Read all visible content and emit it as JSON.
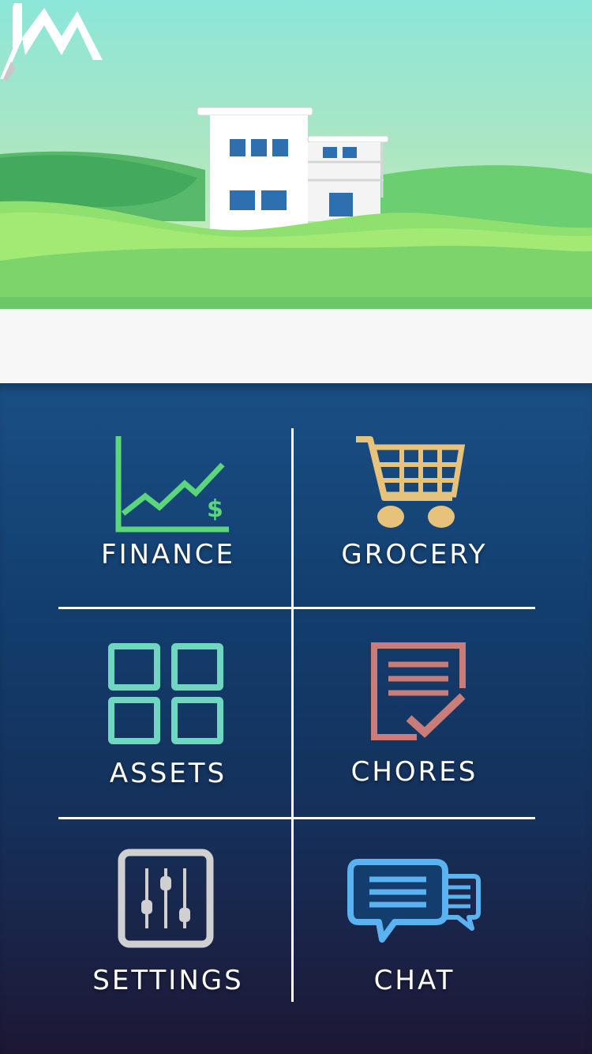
{
  "app": {
    "logo_icon": "jm-mountain-logo-icon",
    "hero_image": "house-on-hills-illustration"
  },
  "menu": {
    "tiles": [
      {
        "label": "FINANCE",
        "icon": "line-chart-dollar-icon",
        "color": "#5cd67a"
      },
      {
        "label": "GROCERY",
        "icon": "shopping-cart-icon",
        "color": "#e6c27a"
      },
      {
        "label": "ASSETS",
        "icon": "grid-squares-icon",
        "color": "#6fd6bf"
      },
      {
        "label": "CHORES",
        "icon": "checklist-icon",
        "color": "#c97c78"
      },
      {
        "label": "SETTINGS",
        "icon": "sliders-icon",
        "color": "#d0d0d0"
      },
      {
        "label": "CHAT",
        "icon": "chat-bubbles-icon",
        "color": "#5ab2f0"
      }
    ]
  }
}
